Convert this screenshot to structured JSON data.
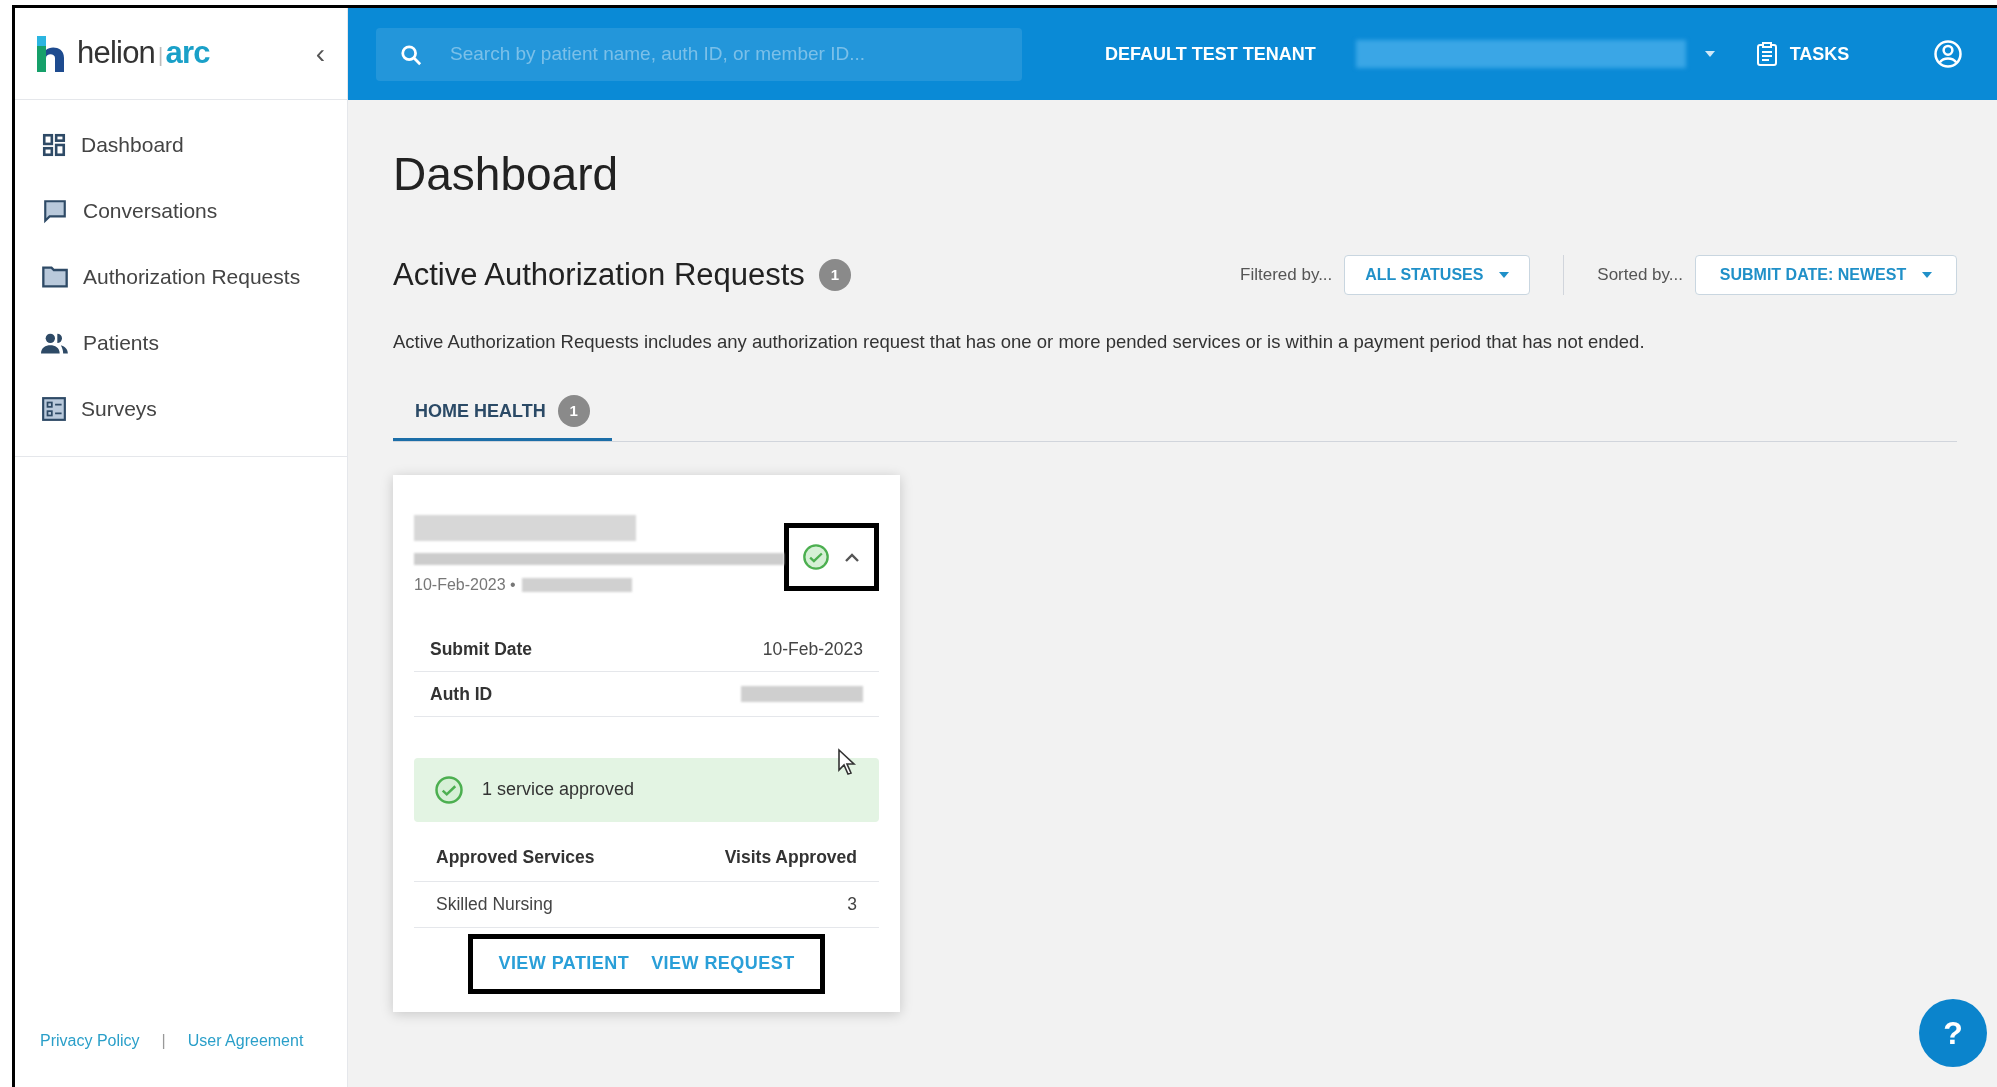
{
  "sidebar": {
    "logo": {
      "word": "helion",
      "separator": "|",
      "accent": "arc"
    },
    "collapse_icon": "‹",
    "items": [
      {
        "label": "Dashboard",
        "kind": "dashboard",
        "selected": false
      },
      {
        "label": "Conversations",
        "kind": "chat",
        "selected": false
      },
      {
        "label": "Authorization Requests",
        "kind": "folder",
        "selected": false
      },
      {
        "label": "Patients",
        "kind": "people",
        "selected": false
      },
      {
        "label": "Surveys",
        "kind": "list",
        "selected": false
      }
    ],
    "footer_links": [
      "Privacy Policy",
      "User Agreement"
    ],
    "footer_separator": "|"
  },
  "top_bar": {
    "search": {
      "placeholder": "Search by patient name, auth ID, or member ID..."
    },
    "tenant": "DEFAULT TEST TENANT",
    "tasks": "TASKS"
  },
  "page": {
    "title": "Dashboard",
    "section": {
      "title": "Active Authorization Requests",
      "count": "1",
      "filter": {
        "label": "Filtered by...",
        "value": "ALL STATUSES"
      },
      "sort": {
        "label": "Sorted by...",
        "value": "SUBMIT DATE: NEWEST"
      },
      "description": "Active Authorization Requests includes any authorization request that has one or more pended services or is within a payment period that has not ended."
    },
    "tabs": [
      {
        "label": "HOME HEALTH",
        "count": "1",
        "selected": true
      }
    ],
    "cards": [
      {
        "date_line": "10-Feb-2023 •",
        "approved": true,
        "expanded": true,
        "status_highlighted": true,
        "fields": [
          {
            "label": "Submit Date",
            "value": "10-Feb-2023",
            "kind": "text"
          },
          {
            "label": "Auth ID",
            "kind": "redacted"
          }
        ],
        "banner": "1 service approved",
        "services_header": [
          "Approved Services",
          "Visits Approved"
        ],
        "services": [
          {
            "name": "Skilled Nursing",
            "visits": "3"
          }
        ],
        "actions": [
          "VIEW PATIENT",
          "VIEW REQUEST"
        ],
        "actions_highlighted": true
      }
    ]
  },
  "help_button": "?"
}
